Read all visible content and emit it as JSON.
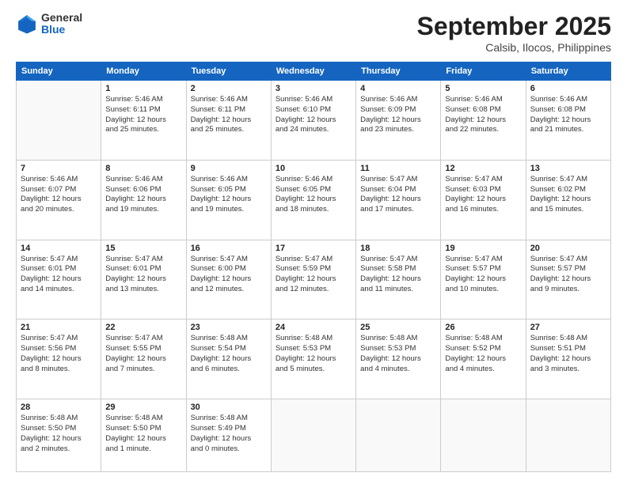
{
  "header": {
    "logo_general": "General",
    "logo_blue": "Blue",
    "month_title": "September 2025",
    "location": "Calsib, Ilocos, Philippines"
  },
  "days_of_week": [
    "Sunday",
    "Monday",
    "Tuesday",
    "Wednesday",
    "Thursday",
    "Friday",
    "Saturday"
  ],
  "weeks": [
    [
      {
        "day": "",
        "info": ""
      },
      {
        "day": "1",
        "info": "Sunrise: 5:46 AM\nSunset: 6:11 PM\nDaylight: 12 hours\nand 25 minutes."
      },
      {
        "day": "2",
        "info": "Sunrise: 5:46 AM\nSunset: 6:11 PM\nDaylight: 12 hours\nand 25 minutes."
      },
      {
        "day": "3",
        "info": "Sunrise: 5:46 AM\nSunset: 6:10 PM\nDaylight: 12 hours\nand 24 minutes."
      },
      {
        "day": "4",
        "info": "Sunrise: 5:46 AM\nSunset: 6:09 PM\nDaylight: 12 hours\nand 23 minutes."
      },
      {
        "day": "5",
        "info": "Sunrise: 5:46 AM\nSunset: 6:08 PM\nDaylight: 12 hours\nand 22 minutes."
      },
      {
        "day": "6",
        "info": "Sunrise: 5:46 AM\nSunset: 6:08 PM\nDaylight: 12 hours\nand 21 minutes."
      }
    ],
    [
      {
        "day": "7",
        "info": "Sunrise: 5:46 AM\nSunset: 6:07 PM\nDaylight: 12 hours\nand 20 minutes."
      },
      {
        "day": "8",
        "info": "Sunrise: 5:46 AM\nSunset: 6:06 PM\nDaylight: 12 hours\nand 19 minutes."
      },
      {
        "day": "9",
        "info": "Sunrise: 5:46 AM\nSunset: 6:05 PM\nDaylight: 12 hours\nand 19 minutes."
      },
      {
        "day": "10",
        "info": "Sunrise: 5:46 AM\nSunset: 6:05 PM\nDaylight: 12 hours\nand 18 minutes."
      },
      {
        "day": "11",
        "info": "Sunrise: 5:47 AM\nSunset: 6:04 PM\nDaylight: 12 hours\nand 17 minutes."
      },
      {
        "day": "12",
        "info": "Sunrise: 5:47 AM\nSunset: 6:03 PM\nDaylight: 12 hours\nand 16 minutes."
      },
      {
        "day": "13",
        "info": "Sunrise: 5:47 AM\nSunset: 6:02 PM\nDaylight: 12 hours\nand 15 minutes."
      }
    ],
    [
      {
        "day": "14",
        "info": "Sunrise: 5:47 AM\nSunset: 6:01 PM\nDaylight: 12 hours\nand 14 minutes."
      },
      {
        "day": "15",
        "info": "Sunrise: 5:47 AM\nSunset: 6:01 PM\nDaylight: 12 hours\nand 13 minutes."
      },
      {
        "day": "16",
        "info": "Sunrise: 5:47 AM\nSunset: 6:00 PM\nDaylight: 12 hours\nand 12 minutes."
      },
      {
        "day": "17",
        "info": "Sunrise: 5:47 AM\nSunset: 5:59 PM\nDaylight: 12 hours\nand 12 minutes."
      },
      {
        "day": "18",
        "info": "Sunrise: 5:47 AM\nSunset: 5:58 PM\nDaylight: 12 hours\nand 11 minutes."
      },
      {
        "day": "19",
        "info": "Sunrise: 5:47 AM\nSunset: 5:57 PM\nDaylight: 12 hours\nand 10 minutes."
      },
      {
        "day": "20",
        "info": "Sunrise: 5:47 AM\nSunset: 5:57 PM\nDaylight: 12 hours\nand 9 minutes."
      }
    ],
    [
      {
        "day": "21",
        "info": "Sunrise: 5:47 AM\nSunset: 5:56 PM\nDaylight: 12 hours\nand 8 minutes."
      },
      {
        "day": "22",
        "info": "Sunrise: 5:47 AM\nSunset: 5:55 PM\nDaylight: 12 hours\nand 7 minutes."
      },
      {
        "day": "23",
        "info": "Sunrise: 5:48 AM\nSunset: 5:54 PM\nDaylight: 12 hours\nand 6 minutes."
      },
      {
        "day": "24",
        "info": "Sunrise: 5:48 AM\nSunset: 5:53 PM\nDaylight: 12 hours\nand 5 minutes."
      },
      {
        "day": "25",
        "info": "Sunrise: 5:48 AM\nSunset: 5:53 PM\nDaylight: 12 hours\nand 4 minutes."
      },
      {
        "day": "26",
        "info": "Sunrise: 5:48 AM\nSunset: 5:52 PM\nDaylight: 12 hours\nand 4 minutes."
      },
      {
        "day": "27",
        "info": "Sunrise: 5:48 AM\nSunset: 5:51 PM\nDaylight: 12 hours\nand 3 minutes."
      }
    ],
    [
      {
        "day": "28",
        "info": "Sunrise: 5:48 AM\nSunset: 5:50 PM\nDaylight: 12 hours\nand 2 minutes."
      },
      {
        "day": "29",
        "info": "Sunrise: 5:48 AM\nSunset: 5:50 PM\nDaylight: 12 hours\nand 1 minute."
      },
      {
        "day": "30",
        "info": "Sunrise: 5:48 AM\nSunset: 5:49 PM\nDaylight: 12 hours\nand 0 minutes."
      },
      {
        "day": "",
        "info": ""
      },
      {
        "day": "",
        "info": ""
      },
      {
        "day": "",
        "info": ""
      },
      {
        "day": "",
        "info": ""
      }
    ]
  ]
}
